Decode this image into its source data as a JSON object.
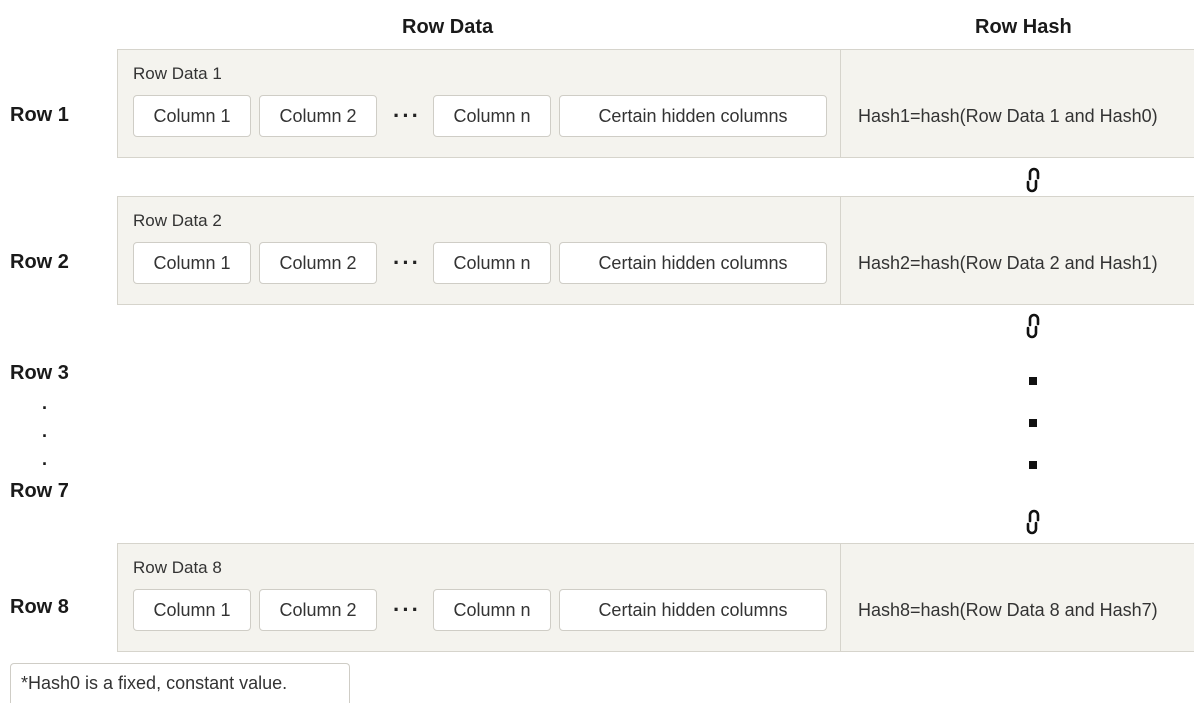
{
  "headers": {
    "row_data": "Row Data",
    "row_hash": "Row Hash"
  },
  "rows": [
    {
      "label": "Row 1",
      "data_title": "Row Data 1",
      "cells": [
        "Column 1",
        "Column 2",
        "Column n",
        "Certain hidden columns"
      ],
      "ellipsis": "···",
      "hash": "Hash1=hash(Row Data 1 and Hash0)"
    },
    {
      "label": "Row 2",
      "data_title": "Row Data 2",
      "cells": [
        "Column 1",
        "Column 2",
        "Column n",
        "Certain hidden columns"
      ],
      "ellipsis": "···",
      "hash": "Hash2=hash(Row Data 2 and Hash1)"
    },
    {
      "label": "Row 8",
      "data_title": "Row Data 8",
      "cells": [
        "Column 1",
        "Column 2",
        "Column n",
        "Certain hidden columns"
      ],
      "ellipsis": "···",
      "hash": "Hash8=hash(Row Data 8 and Hash7)"
    }
  ],
  "gap": {
    "start_label": "Row 3",
    "dots": [
      ".",
      ".",
      "."
    ],
    "end_label": "Row 7"
  },
  "icons": {
    "link": "chain-link-icon",
    "continuation": "square-dot"
  },
  "footnote": "*Hash0 is a fixed, constant value."
}
